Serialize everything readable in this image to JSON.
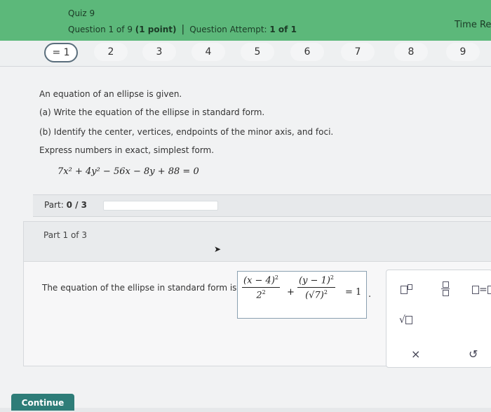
{
  "header": {
    "quiz_title": "Quiz 9",
    "question_position": "Question 1 of 9",
    "question_points": "(1 point)",
    "attempt_label": "Question Attempt:",
    "attempt_value": "1 of 1",
    "time_label": "Time Re",
    "color": "#5cb87a"
  },
  "question_nav": {
    "items": [
      "= 1",
      "2",
      "3",
      "4",
      "5",
      "6",
      "7",
      "8",
      "9"
    ],
    "current_index": 0
  },
  "problem": {
    "intro": "An equation of an ellipse is given.",
    "part_a": "(a) Write the equation of the ellipse in standard form.",
    "part_b": "(b) Identify the center, vertices, endpoints of the minor axis, and foci.",
    "instruction": "Express numbers in exact, simplest form.",
    "equation": "7x² + 4y² − 56x − 8y + 88 = 0"
  },
  "progress": {
    "label": "Part:",
    "value": "0 / 3",
    "fraction": 0
  },
  "part": {
    "header": "Part 1 of 3",
    "prompt": "The equation of the ellipse in standard form is",
    "answer": {
      "term1_num": "(x − 4)",
      "term1_num_exp": "2",
      "term1_den": "2",
      "term1_den_exp": "2",
      "plus": "+",
      "term2_num": "(y − 1)",
      "term2_num_exp": "2",
      "term2_den": "(√7)",
      "term2_den_exp": "2",
      "equals": "= 1",
      "period": "."
    }
  },
  "tools": {
    "exponent_icon": "exponent-template-icon",
    "fraction_icon": "fraction-template-icon",
    "equation_icon": "equals-template-icon",
    "sqrt_icon": "square-root-template-icon",
    "clear_symbol": "×",
    "undo_symbol": "↺"
  },
  "footer": {
    "continue_label": "Continue"
  }
}
